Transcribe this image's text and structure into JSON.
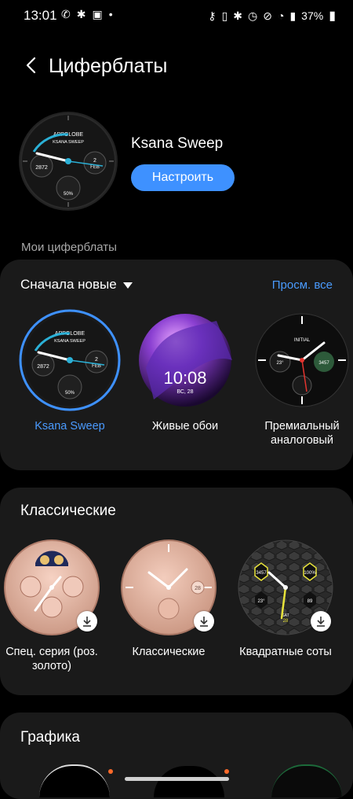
{
  "status": {
    "time": "13:01",
    "battery": "37%"
  },
  "header": {
    "title": "Циферблаты"
  },
  "current": {
    "name": "Ksana Sweep",
    "setup_label": "Настроить"
  },
  "my_faces": {
    "section_label": "Мои циферблаты",
    "sort_label": "Сначала новые",
    "view_all": "Просм. все",
    "items": [
      {
        "label": "Ksana Sweep",
        "selected": true
      },
      {
        "label": "Живые обои"
      },
      {
        "label": "Премиальный аналоговый"
      }
    ],
    "live_time": "10:08",
    "live_date": "ВС, 28",
    "ksana_brand": "APPGLOBE",
    "ksana_sub": "KSANA SWEEP",
    "ksana_steps": "2872",
    "ksana_date": "2",
    "ksana_month": "FEB",
    "ksana_batt": "50%",
    "premium_brand": "INITIAL",
    "premium_temp": "23°",
    "premium_steps": "3457"
  },
  "classic": {
    "title": "Классические",
    "items": [
      {
        "label": "Спец. серия (роз. золото)"
      },
      {
        "label": "Классические"
      },
      {
        "label": "Квадратные соты"
      }
    ],
    "classic_date": "28",
    "honey_top": "3457",
    "honey_pct": "100%",
    "honey_temp": "23°",
    "honey_hr": "89",
    "honey_day": "SAT",
    "honey_date": "28"
  },
  "graphics": {
    "title": "Графика"
  },
  "colors": {
    "accent": "#3e91ff",
    "link": "#4a9bff",
    "card": "#1a1a1a"
  }
}
